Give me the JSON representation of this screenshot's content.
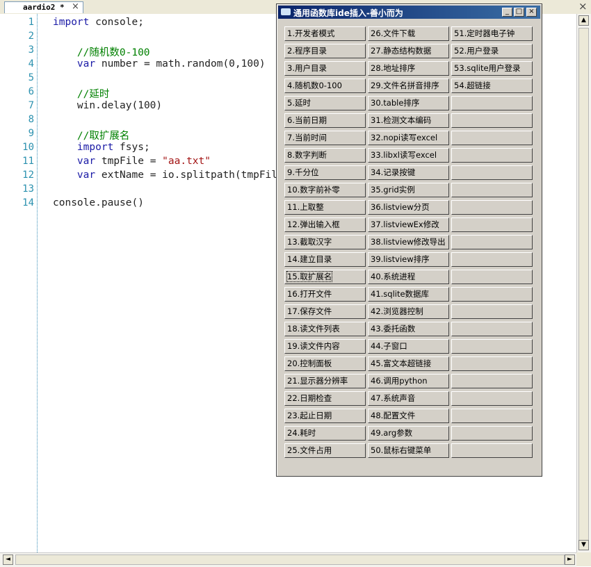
{
  "tab": {
    "label": "aardio2 *",
    "close": "×"
  },
  "window": {
    "close": "×"
  },
  "editor": {
    "line_numbers": [
      "1",
      "2",
      "3",
      "4",
      "5",
      "6",
      "7",
      "8",
      "9",
      "10",
      "11",
      "12",
      "13",
      "14"
    ],
    "code": [
      [
        {
          "t": "kw",
          "v": "import"
        },
        {
          "t": "n",
          "v": " console;"
        }
      ],
      [],
      [
        {
          "t": "n",
          "v": "    "
        },
        {
          "t": "cm",
          "v": "//随机数0-100"
        }
      ],
      [
        {
          "t": "n",
          "v": "    "
        },
        {
          "t": "kw",
          "v": "var"
        },
        {
          "t": "n",
          "v": " number = math.random(0,100)"
        }
      ],
      [],
      [
        {
          "t": "n",
          "v": "    "
        },
        {
          "t": "cm",
          "v": "//延时"
        }
      ],
      [
        {
          "t": "n",
          "v": "    win.delay(100)"
        }
      ],
      [],
      [
        {
          "t": "n",
          "v": "    "
        },
        {
          "t": "cm",
          "v": "//取扩展名"
        }
      ],
      [
        {
          "t": "n",
          "v": "    "
        },
        {
          "t": "kw",
          "v": "import"
        },
        {
          "t": "n",
          "v": " fsys;"
        }
      ],
      [
        {
          "t": "n",
          "v": "    "
        },
        {
          "t": "kw",
          "v": "var"
        },
        {
          "t": "n",
          "v": " tmpFile = "
        },
        {
          "t": "st",
          "v": "\"aa.txt\""
        }
      ],
      [
        {
          "t": "n",
          "v": "    "
        },
        {
          "t": "kw",
          "v": "var"
        },
        {
          "t": "n",
          "v": " extName = io.splitpath(tmpFile).ext"
        }
      ],
      [],
      [
        {
          "t": "n",
          "v": "console.pause()"
        }
      ]
    ]
  },
  "scroll": {
    "up": "▲",
    "down": "▼",
    "left": "◄",
    "right": "►"
  },
  "dialog": {
    "title": "通用函数库ide插入-善小而为",
    "buttons": {
      "minimize": "_",
      "maximize": "□",
      "close": "×"
    },
    "columns": [
      [
        "1.开发者模式",
        "2.程序目录",
        "3.用户目录",
        "4.随机数0-100",
        "5.延时",
        "6.当前日期",
        "7.当前时间",
        "8.数字判断",
        "9.千分位",
        "10.数字前补零",
        "11.上取整",
        "12.弹出输入框",
        "13.截取汉字",
        "14.建立目录",
        "15.取扩展名",
        "16.打开文件",
        "17.保存文件",
        "18.读文件列表",
        "19.读文件内容",
        "20.控制面板",
        "21.显示器分辨率",
        "22.日期检查",
        "23.起止日期",
        "24.耗时",
        "25.文件占用"
      ],
      [
        "26.文件下载",
        "27.静态结构数据",
        "28.地址排序",
        "29.文件名拼音排序",
        "30.table排序",
        "31.检测文本编码",
        "32.nopi读写excel",
        "33.libxl读写excel",
        "34.记录按键",
        "35.grid实例",
        "36.listview分页",
        "37.listviewEx修改",
        "38.listview修改导出",
        "39.listview排序",
        "40.系统进程",
        "41.sqlite数据库",
        "42.浏览器控制",
        "43.委托函数",
        "44.子窗口",
        "45.富文本超链接",
        "46.调用python",
        "47.系统声音",
        "48.配置文件",
        "49.arg参数",
        "50.鼠标右键菜单"
      ],
      [
        "51.定时器电子钟",
        "52.用户登录",
        "53.sqlite用户登录",
        "54.超链接",
        "",
        "",
        "",
        "",
        "",
        "",
        "",
        "",
        "",
        "",
        "",
        "",
        "",
        "",
        "",
        "",
        "",
        "",
        "",
        "",
        ""
      ]
    ],
    "focused_item": "15.取扩展名"
  }
}
